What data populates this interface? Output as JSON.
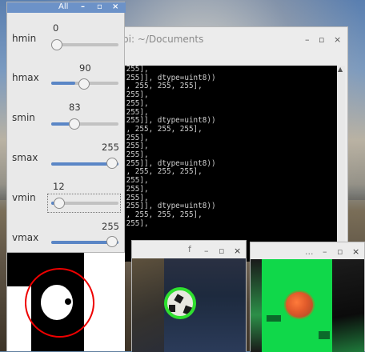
{
  "trackbar_window": {
    "title": "All",
    "controls": {
      "minimize": "–",
      "maximize": "▫",
      "close": "×"
    },
    "trackbars": [
      {
        "name": "hmin",
        "value": "0",
        "max": 255
      },
      {
        "name": "hmax",
        "value": "90",
        "max": 255
      },
      {
        "name": "smin",
        "value": "83",
        "max": 255
      },
      {
        "name": "smax",
        "value": "255",
        "max": 255
      },
      {
        "name": "vmin",
        "value": "12",
        "max": 255
      },
      {
        "name": "vmax",
        "value": "255",
        "max": 255
      }
    ]
  },
  "terminal": {
    "title": "pi: ~/Documents",
    "controls": {
      "minimize": "–",
      "maximize": "▫",
      "close": "×"
    },
    "lines": [
      "[255],",
      "[255]], dtype=uint8))",
      "[, 255, 255, 255],",
      "[255],",
      "",
      "[255],",
      "[255],",
      "[255]], dtype=uint8))",
      "[, 255, 255, 255],",
      "[255],",
      "",
      "[255],",
      "[255],",
      "[255]], dtype=uint8))",
      "[, 255, 255, 255],",
      "[255],",
      "",
      "[255],",
      "[255],",
      "[255]], dtype=uint8))",
      "[, 255, 255, 255],",
      "[255],"
    ]
  },
  "frame_window": {
    "title": "f",
    "controls": {
      "minimize": "–",
      "maximize": "▫",
      "close": "×"
    }
  },
  "hsv_window": {
    "title": "...",
    "controls": {
      "minimize": "–",
      "maximize": "▫",
      "close": "×"
    }
  },
  "colors": {
    "accent": "#5a86c6",
    "detection_circle": "#e00000",
    "ball_outline": "#2fe02f",
    "mask_green": "#10d84a"
  },
  "icons": [
    "minimize-icon",
    "maximize-icon",
    "close-icon",
    "scroll-up-icon"
  ]
}
